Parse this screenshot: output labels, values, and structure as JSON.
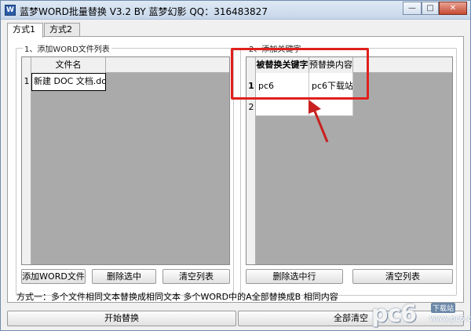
{
  "window": {
    "title": "蓝梦WORD批量替换 V3.2 BY 蓝梦幻影 QQ：316483827",
    "app_icon_glyph": "W",
    "min_glyph": "—",
    "max_glyph": "□",
    "close_glyph": "✕"
  },
  "tabs": [
    {
      "label": "方式1",
      "active": true
    },
    {
      "label": "方式2",
      "active": false
    }
  ],
  "left_group": {
    "caption": "1、添加WORD文件列表",
    "column_header": "文件名",
    "rows": [
      {
        "num": "1",
        "filename": "新建 DOC 文档.doc"
      }
    ]
  },
  "right_group": {
    "caption": "2、添加关键字",
    "column_headers": [
      "被替换关键字",
      "预替换内容"
    ],
    "rows": [
      {
        "num": "1",
        "keyword": "pc6",
        "replacement": "pc6下载站"
      },
      {
        "num": "2",
        "keyword": "",
        "replacement": ""
      }
    ]
  },
  "buttons": {
    "add_word_file": "添加WORD文件",
    "delete_selected_left": "删除选中",
    "clear_list_left": "清空列表",
    "delete_selected_row": "删除选中行",
    "clear_list_right": "清空列表",
    "start_replace": "开始替换",
    "clear_all": "全部清空"
  },
  "hint_text": "方式一：多个文件相同文本替换成相同文本   多个WORD中的A全部替换成B 相同内容",
  "watermark": {
    "logo": "pc6",
    "badge": "下载站",
    "url": "www.pc6.com"
  },
  "colors": {
    "highlight_border": "#e0201c",
    "arrow": "#c8211f"
  }
}
